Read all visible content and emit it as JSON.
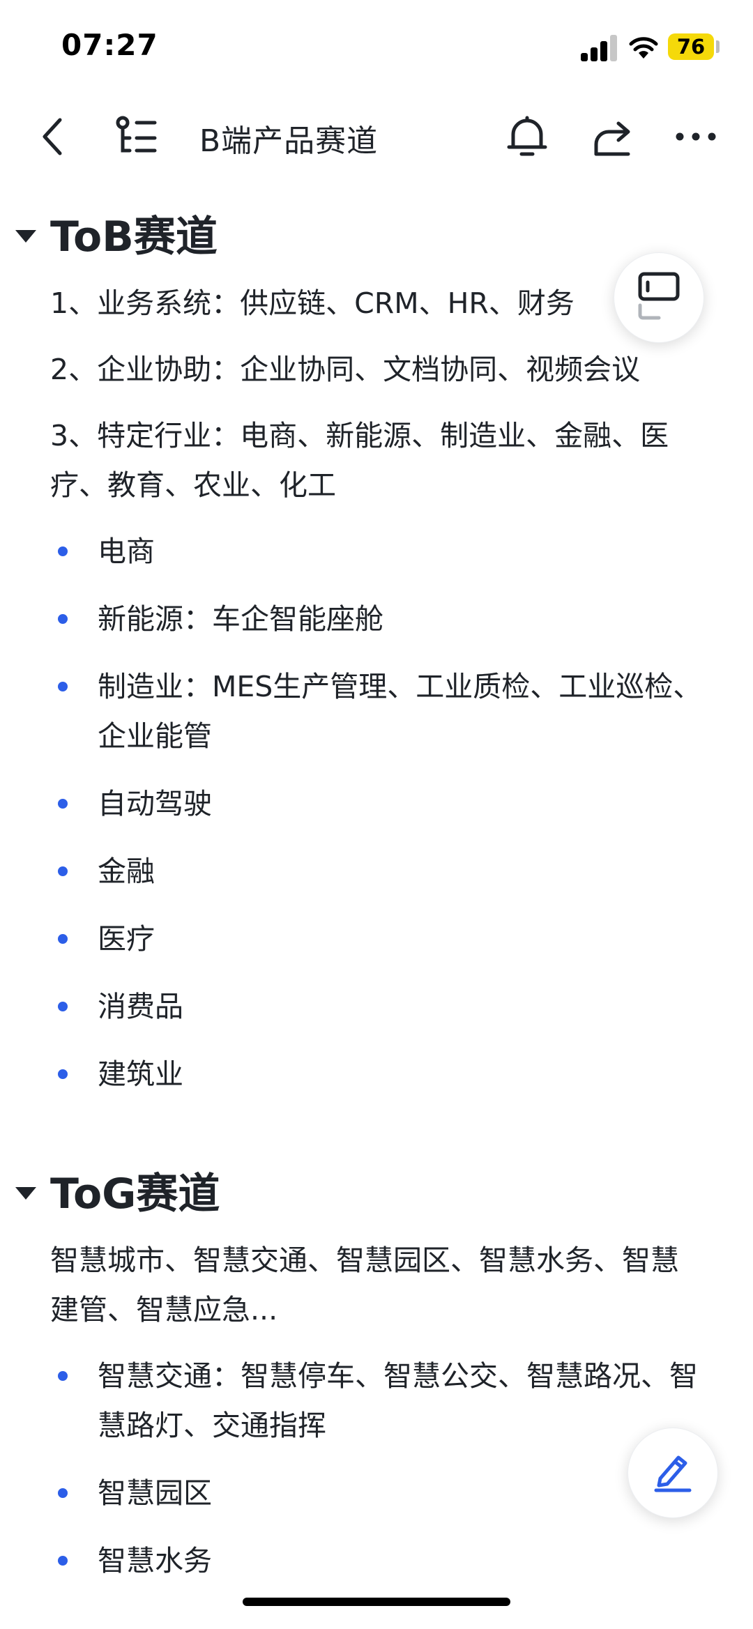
{
  "status_bar": {
    "time": "07:27",
    "battery": "76"
  },
  "nav": {
    "title": "B端产品赛道",
    "icons": [
      "back-icon",
      "outline-icon",
      "bell-icon",
      "share-icon",
      "more-icon"
    ]
  },
  "sections": {
    "tob": {
      "title": "ToB赛道",
      "paras": [
        "1、业务系统：供应链、CRM、HR、财务",
        "2、企业协助：企业协同、文档协同、视频会议",
        "3、特定行业：电商、新能源、制造业、金融、医疗、教育、农业、化工"
      ],
      "bullets": [
        "电商",
        "新能源：车企智能座舱",
        "制造业：MES生产管理、工业质检、工业巡检、企业能管",
        "自动驾驶",
        "金融",
        "医疗",
        "消费品",
        "建筑业"
      ]
    },
    "tog": {
      "title": "ToG赛道",
      "paras": [
        "智慧城市、智慧交通、智慧园区、智慧水务、智慧建管、智慧应急..."
      ],
      "bullets": [
        "智慧交通：智慧停车、智慧公交、智慧路况、智慧路灯、交通指挥",
        "智慧园区",
        "智慧水务"
      ]
    }
  },
  "colors": {
    "accent": "#2c5ee8",
    "text": "#1f2329",
    "battery": "#f5d90a"
  },
  "floating": {
    "top_icon": "sidebar-toggle-icon",
    "bottom_icon": "edit-icon"
  }
}
